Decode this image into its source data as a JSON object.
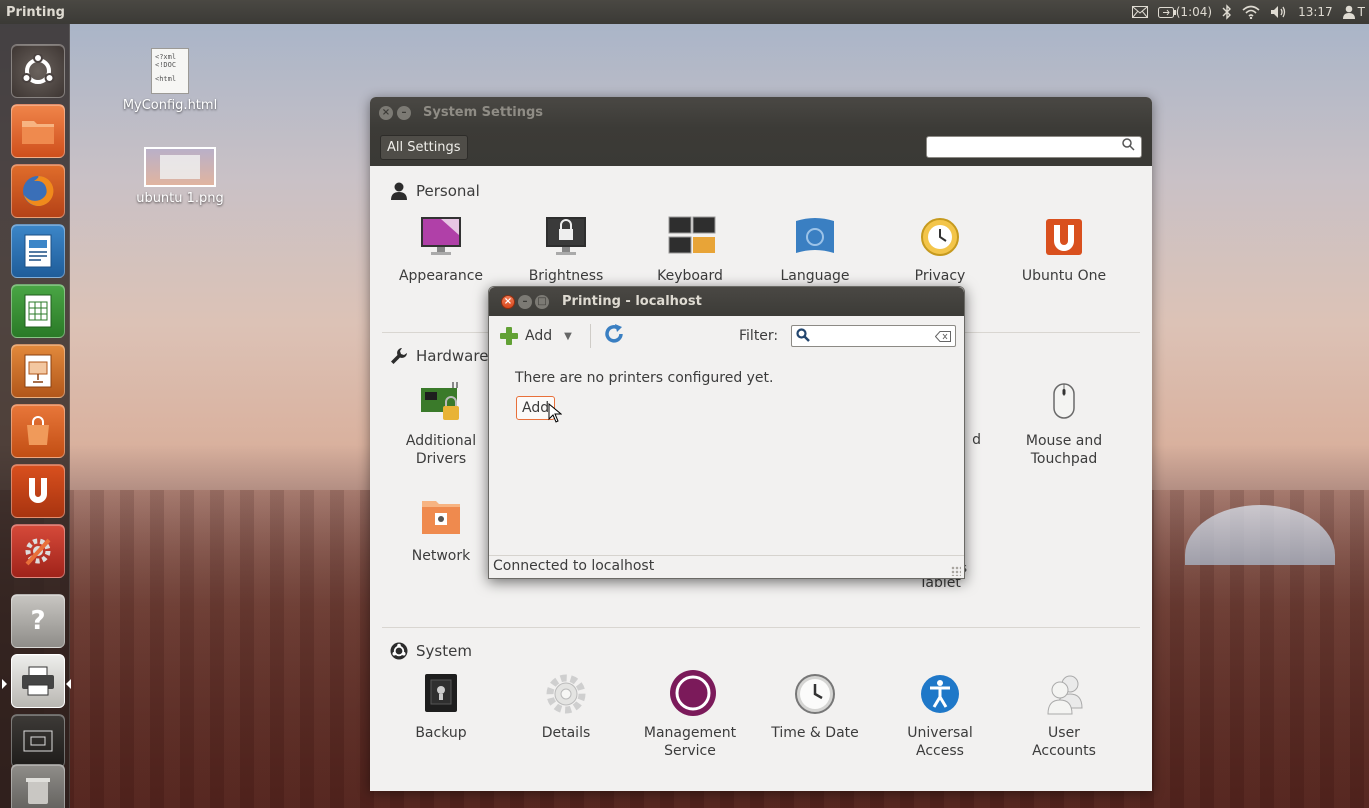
{
  "top_panel": {
    "app_title": "Printing",
    "battery": "(1:04)",
    "time": "13:17",
    "user_initial": "T"
  },
  "launcher": {
    "items": [
      {
        "name": "dash",
        "icon": "ubuntu-logo-icon"
      },
      {
        "name": "files",
        "icon": "folder-icon"
      },
      {
        "name": "firefox",
        "icon": "firefox-icon"
      },
      {
        "name": "writer",
        "icon": "libreoffice-writer-icon"
      },
      {
        "name": "calc",
        "icon": "libreoffice-calc-icon"
      },
      {
        "name": "impress",
        "icon": "libreoffice-impress-icon"
      },
      {
        "name": "software-center",
        "icon": "shopping-bag-icon"
      },
      {
        "name": "ubuntu-one",
        "icon": "ubuntu-one-icon"
      },
      {
        "name": "system-settings",
        "icon": "settings-icon"
      },
      {
        "name": "help",
        "icon": "help-icon",
        "glyph": "?"
      },
      {
        "name": "printing",
        "icon": "printer-icon"
      },
      {
        "name": "workspaces",
        "icon": "workspace-switcher-icon"
      },
      {
        "name": "trash",
        "icon": "trash-icon"
      }
    ]
  },
  "desktop": {
    "file1": {
      "label": "MyConfig.html",
      "preview": [
        "<?xml",
        "<!DOC",
        "<html"
      ]
    },
    "file2": {
      "label": "ubuntu 1.png"
    }
  },
  "settings": {
    "title": "System Settings",
    "all_settings_label": "All Settings",
    "search_placeholder": "",
    "personal": {
      "heading": "Personal",
      "items": [
        "Appearance",
        "Brightness",
        "Keyboard",
        "Language",
        "Privacy",
        "Ubuntu One"
      ]
    },
    "hardware": {
      "heading": "Hardware",
      "items": [
        {
          "line1": "Additional",
          "line2": "Drivers"
        },
        {
          "line1": "Network",
          "line2": ""
        },
        {
          "line1": "d",
          "line2": ""
        },
        {
          "line1": "Mouse and",
          "line2": "Touchpad"
        },
        {
          "line1": "s",
          "line2": "Tablet"
        }
      ]
    },
    "system": {
      "heading": "System",
      "items": [
        {
          "line1": "Backup",
          "line2": ""
        },
        {
          "line1": "Details",
          "line2": ""
        },
        {
          "line1": "Management",
          "line2": "Service"
        },
        {
          "line1": "Time & Date",
          "line2": ""
        },
        {
          "line1": "Universal",
          "line2": "Access"
        },
        {
          "line1": "User",
          "line2": "Accounts"
        }
      ]
    }
  },
  "printing": {
    "title": "Printing - localhost",
    "add_label": "Add",
    "filter_label": "Filter:",
    "filter_value": "",
    "empty_message": "There are no printers configured yet.",
    "add_button_label": "Add",
    "status": "Connected to localhost"
  },
  "colors": {
    "accent_orange": "#e8703a",
    "panel_dark": "#3c3b37",
    "window_bg": "#f2f1f0"
  }
}
